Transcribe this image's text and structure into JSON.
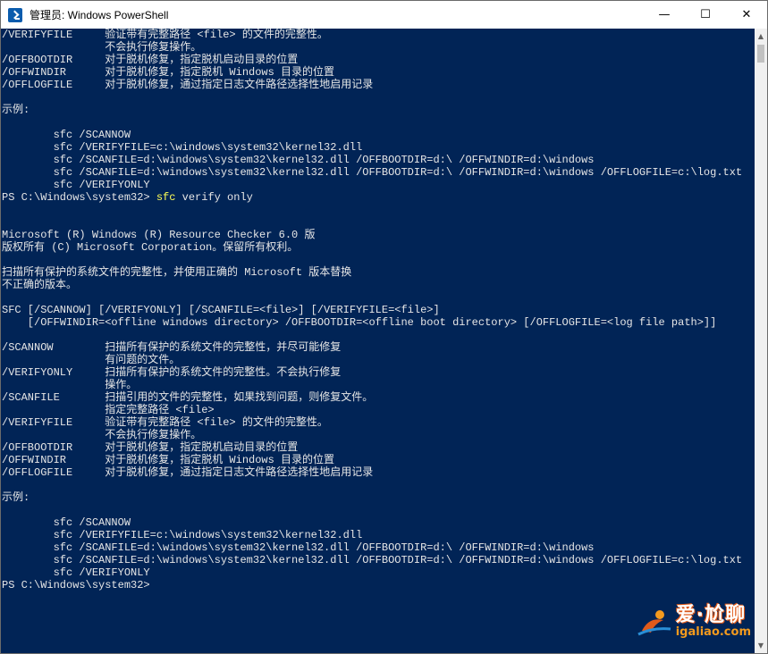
{
  "window": {
    "title": "管理员: Windows PowerShell",
    "minimize_symbol": "—",
    "maximize_symbol": "☐",
    "close_symbol": "✕"
  },
  "console": {
    "lines": [
      "/VERIFYFILE     验证带有完整路径 <file> 的文件的完整性。",
      "                不会执行修复操作。",
      "/OFFBOOTDIR     对于脱机修复，指定脱机启动目录的位置",
      "/OFFWINDIR      对于脱机修复，指定脱机 Windows 目录的位置",
      "/OFFLOGFILE     对于脱机修复，通过指定日志文件路径选择性地启用记录",
      "",
      "示例:",
      "",
      "        sfc /SCANNOW",
      "        sfc /VERIFYFILE=c:\\windows\\system32\\kernel32.dll",
      "        sfc /SCANFILE=d:\\windows\\system32\\kernel32.dll /OFFBOOTDIR=d:\\ /OFFWINDIR=d:\\windows",
      "        sfc /SCANFILE=d:\\windows\\system32\\kernel32.dll /OFFBOOTDIR=d:\\ /OFFWINDIR=d:\\windows /OFFLOGFILE=c:\\log.txt",
      "        sfc /VERIFYONLY",
      "",
      "",
      "Microsoft (R) Windows (R) Resource Checker 6.0 版",
      "版权所有 (C) Microsoft Corporation。保留所有权利。",
      "",
      "扫描所有保护的系统文件的完整性，并使用正确的 Microsoft 版本替换",
      "不正确的版本。",
      "",
      "SFC [/SCANNOW] [/VERIFYONLY] [/SCANFILE=<file>] [/VERIFYFILE=<file>]",
      "    [/OFFWINDIR=<offline windows directory> /OFFBOOTDIR=<offline boot directory> [/OFFLOGFILE=<log file path>]]",
      "",
      "/SCANNOW        扫描所有保护的系统文件的完整性，并尽可能修复",
      "                有问题的文件。",
      "/VERIFYONLY     扫描所有保护的系统文件的完整性。不会执行修复",
      "                操作。",
      "/SCANFILE       扫描引用的文件的完整性，如果找到问题，则修复文件。",
      "                指定完整路径 <file>",
      "/VERIFYFILE     验证带有完整路径 <file> 的文件的完整性。",
      "                不会执行修复操作。",
      "/OFFBOOTDIR     对于脱机修复，指定脱机启动目录的位置",
      "/OFFWINDIR      对于脱机修复，指定脱机 Windows 目录的位置",
      "/OFFLOGFILE     对于脱机修复，通过指定日志文件路径选择性地启用记录",
      "",
      "示例:",
      "",
      "        sfc /SCANNOW",
      "        sfc /VERIFYFILE=c:\\windows\\system32\\kernel32.dll",
      "        sfc /SCANFILE=d:\\windows\\system32\\kernel32.dll /OFFBOOTDIR=d:\\ /OFFWINDIR=d:\\windows",
      "        sfc /SCANFILE=d:\\windows\\system32\\kernel32.dll /OFFBOOTDIR=d:\\ /OFFWINDIR=d:\\windows /OFFLOGFILE=c:\\log.txt",
      "        sfc /VERIFYONLY"
    ],
    "prompt1": {
      "prefix": "PS C:\\Windows\\system32> ",
      "command": "sfc",
      "args": " verify only"
    },
    "prompt2": {
      "prefix": "PS C:\\Windows\\system32> "
    }
  },
  "watermark": {
    "brand": "爱·尬聊",
    "url": "igaliao.com"
  },
  "colors": {
    "console_bg": "#012456",
    "console_text": "#e6e6e6",
    "command_text": "#ffff55",
    "titlebar_bg": "#ffffff"
  }
}
